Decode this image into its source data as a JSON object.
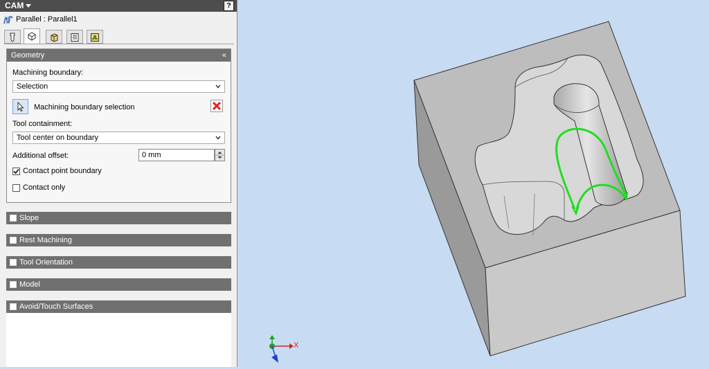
{
  "header": {
    "title": "CAM",
    "help_label": "?"
  },
  "operation": {
    "name": "Parallel : Parallel1",
    "icon": "parallel-op-icon"
  },
  "tabs": [
    {
      "icon": "tool-tab-icon",
      "active": false
    },
    {
      "icon": "geometry-tab-icon",
      "active": true
    },
    {
      "icon": "heights-tab-icon",
      "active": false
    },
    {
      "icon": "passes-tab-icon",
      "active": false
    },
    {
      "icon": "linking-tab-icon",
      "active": false
    }
  ],
  "geometry": {
    "title": "Geometry",
    "machining_boundary_label": "Machining boundary:",
    "machining_boundary_value": "Selection",
    "boundary_selection_label": "Machining boundary selection",
    "tool_containment_label": "Tool containment:",
    "tool_containment_value": "Tool center on boundary",
    "additional_offset_label": "Additional offset:",
    "additional_offset_value": "0 mm",
    "contact_point_label": "Contact point boundary",
    "contact_point_checked": true,
    "contact_only_label": "Contact only",
    "contact_only_checked": false
  },
  "groups": [
    {
      "label": "Slope"
    },
    {
      "label": "Rest Machining"
    },
    {
      "label": "Tool Orientation"
    },
    {
      "label": "Model"
    },
    {
      "label": "Avoid/Touch Surfaces"
    }
  ],
  "axes": {
    "x_label": "X"
  },
  "colors": {
    "toolpath": "#22dd22",
    "header": "#707070",
    "viewport_bg": "#c7dcf2",
    "x_axis": "#d02020",
    "y_axis": "#20a020",
    "z_axis": "#2040d0"
  }
}
